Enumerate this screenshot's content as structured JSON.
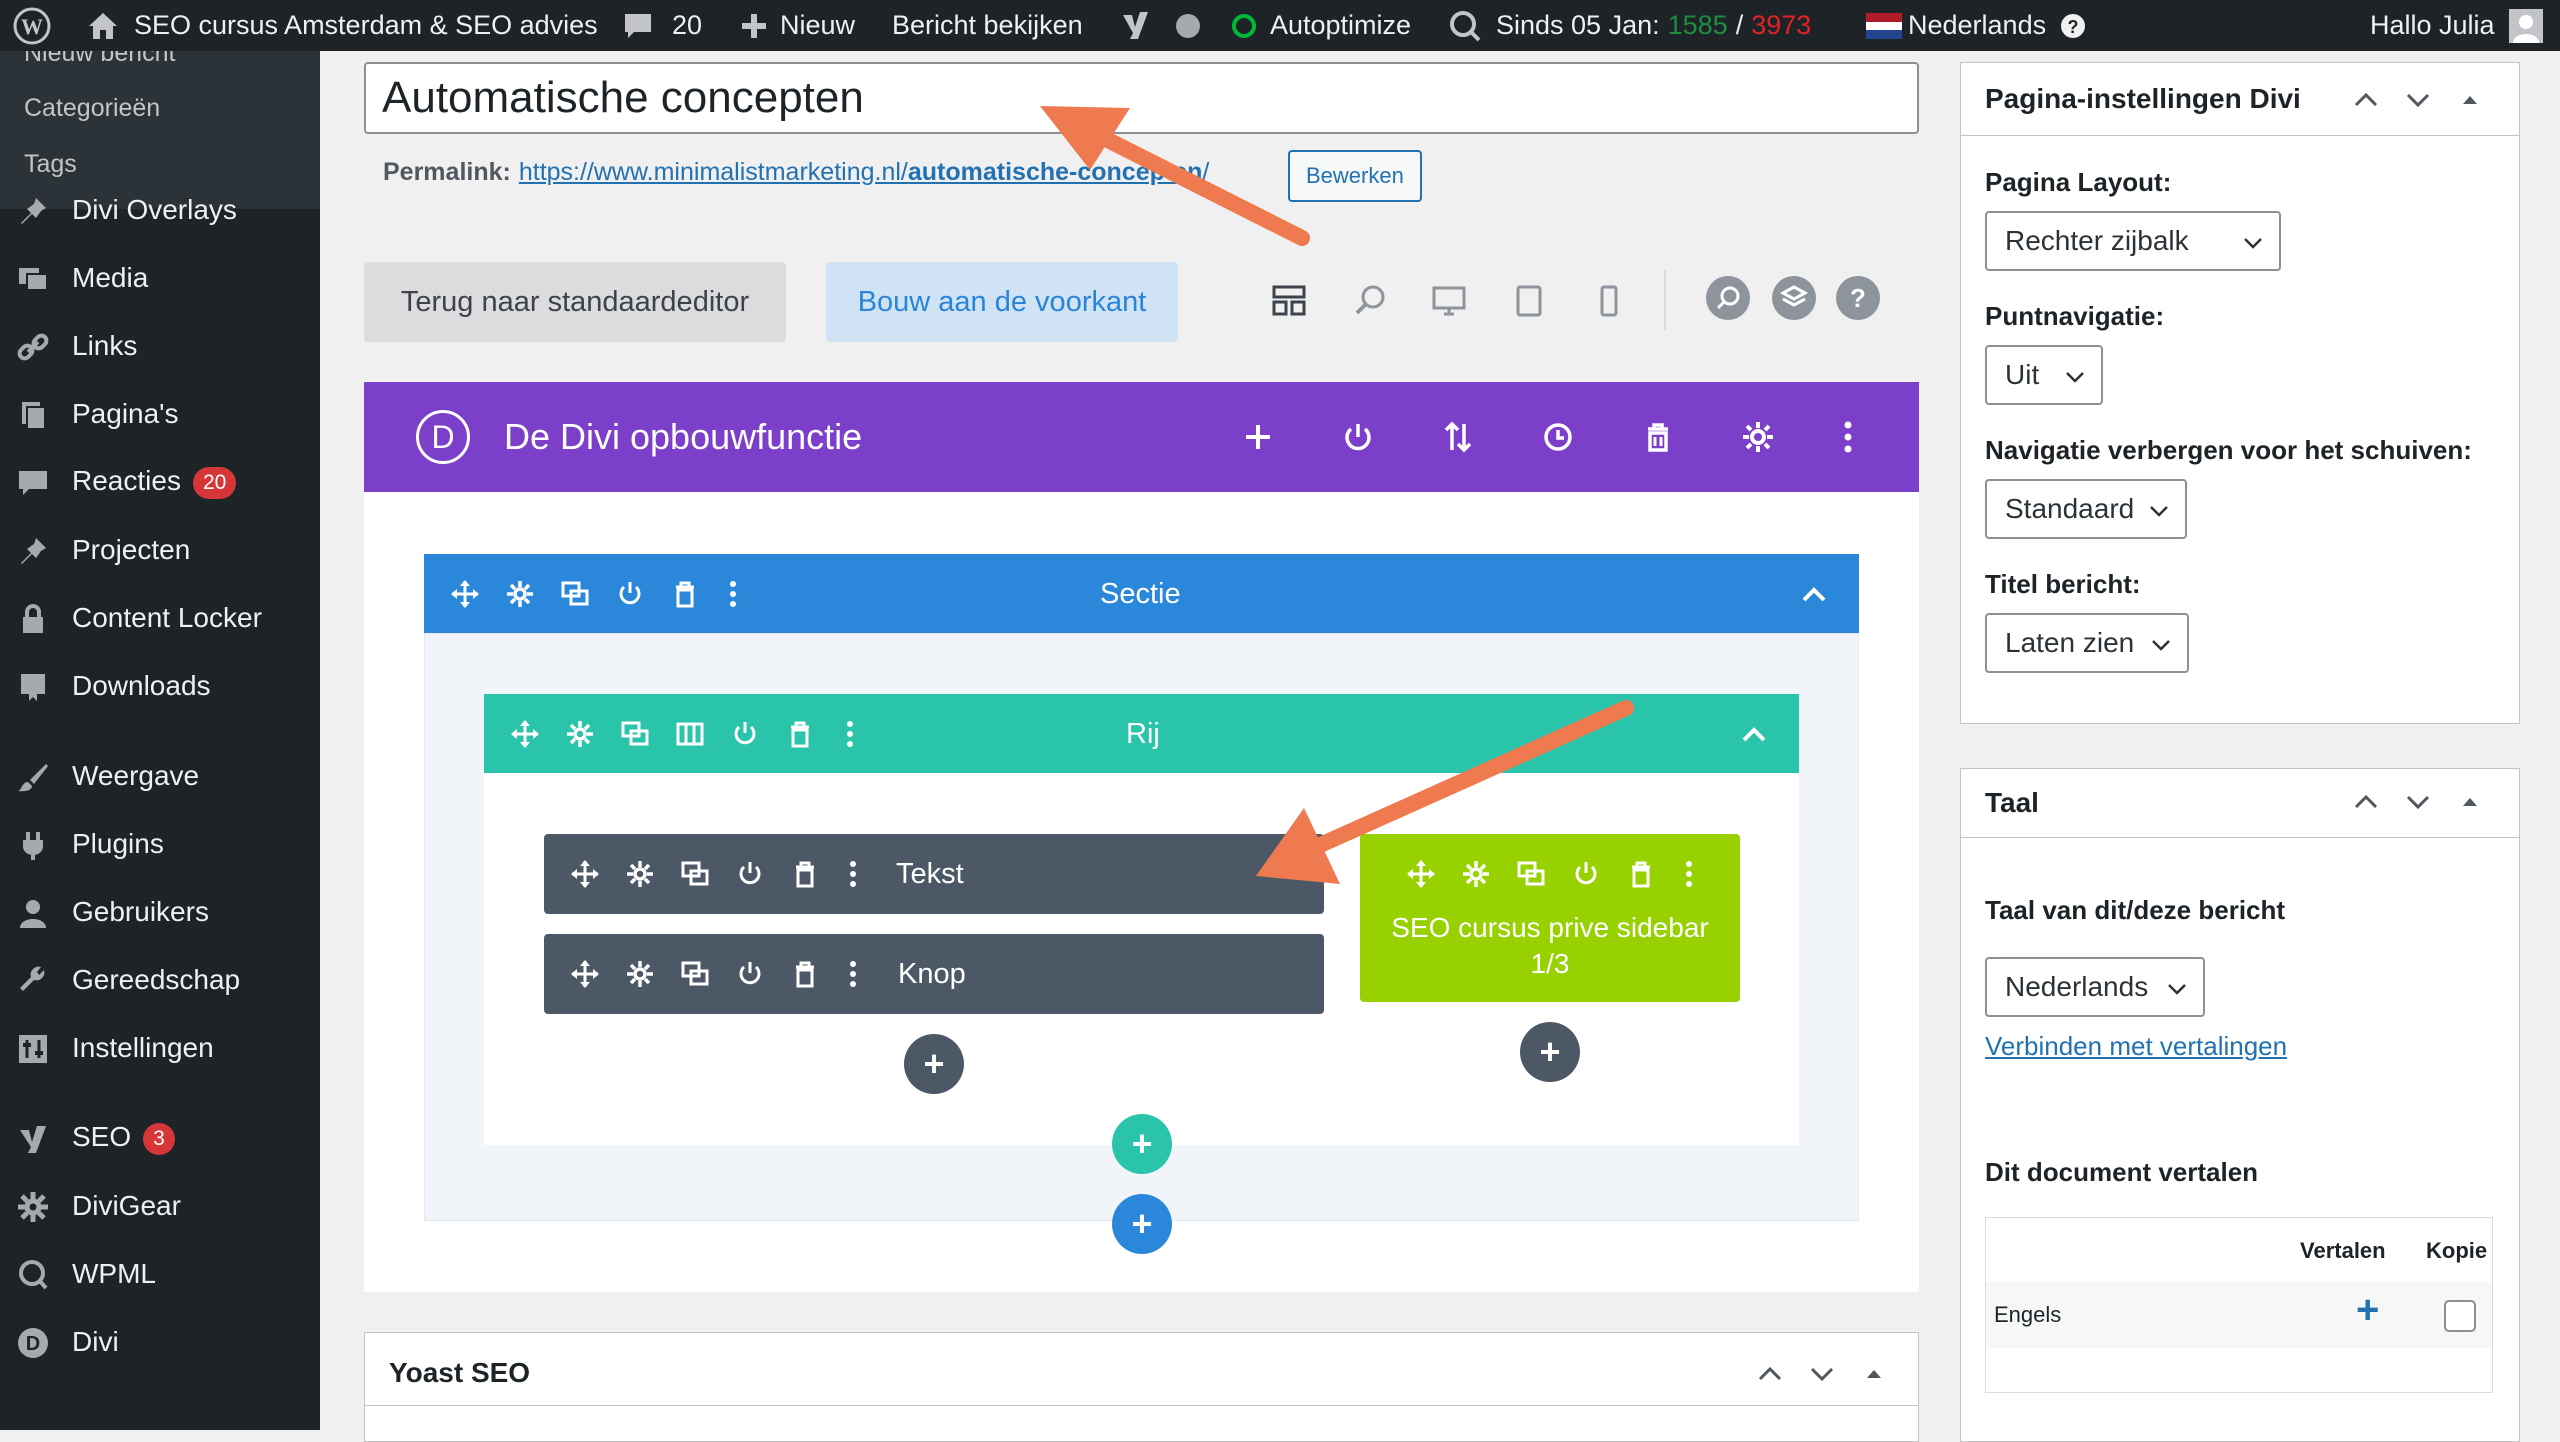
{
  "adminbar": {
    "site_name": "SEO cursus Amsterdam & SEO advies",
    "comments_count": "20",
    "new_label": "Nieuw",
    "view_post": "Bericht bekijken",
    "autoptimize": "Autoptimize",
    "since_label": "Sinds 05 Jan:",
    "stat_green": "1585",
    "stat_sep": "/",
    "stat_red": "3973",
    "language": "Nederlands",
    "greeting": "Hallo Julia"
  },
  "sidebar": {
    "sub_items": [
      "Nieuw bericht",
      "Categorieën",
      "Tags"
    ],
    "items": [
      {
        "label": "Divi Overlays",
        "icon": "pin-icon"
      },
      {
        "label": "Media",
        "icon": "media-icon"
      },
      {
        "label": "Links",
        "icon": "links-icon"
      },
      {
        "label": "Pagina's",
        "icon": "pages-icon"
      },
      {
        "label": "Reacties",
        "icon": "comments-icon",
        "badge": "20"
      },
      {
        "label": "Projecten",
        "icon": "pin-icon"
      },
      {
        "label": "Content Locker",
        "icon": "lock-icon"
      },
      {
        "label": "Downloads",
        "icon": "download-icon"
      },
      {
        "label": "Weergave",
        "icon": "brush-icon"
      },
      {
        "label": "Plugins",
        "icon": "plugin-icon"
      },
      {
        "label": "Gebruikers",
        "icon": "user-icon"
      },
      {
        "label": "Gereedschap",
        "icon": "wrench-icon"
      },
      {
        "label": "Instellingen",
        "icon": "settings-icon"
      },
      {
        "label": "SEO",
        "icon": "yoast-icon",
        "badge": "3"
      },
      {
        "label": "DiviGear",
        "icon": "gear-icon"
      },
      {
        "label": "WPML",
        "icon": "wpml-icon"
      },
      {
        "label": "Divi",
        "icon": "divi-icon"
      }
    ]
  },
  "editor": {
    "title_value": "Automatische concepten",
    "permalink_label": "Permalink:",
    "permalink_base": "https://www.minimalistmarketing.nl/",
    "permalink_slug": "automatische-concepten",
    "permalink_end": "/",
    "edit_button": "Bewerken",
    "back_button": "Terug naar standaardeditor",
    "frontend_button": "Bouw aan de voorkant"
  },
  "divi": {
    "builder_title": "De Divi opbouwfunctie",
    "logo_letter": "D",
    "section_label": "Sectie",
    "row_label": "Rij",
    "modules": [
      "Tekst",
      "Knop"
    ],
    "sidebar_module_line1": "SEO cursus prive sidebar",
    "sidebar_module_line2": "1/3",
    "add_symbol": "+"
  },
  "panel_settings": {
    "title": "Pagina-instellingen Divi",
    "layout_label": "Pagina Layout:",
    "layout_value": "Rechter zijbalk",
    "dotnav_label": "Puntnavigatie:",
    "dotnav_value": "Uit",
    "hidenav_label": "Navigatie verbergen voor het schuiven:",
    "hidenav_value": "Standaard",
    "posttitle_label": "Titel bericht:",
    "posttitle_value": "Laten zien"
  },
  "panel_language": {
    "title": "Taal",
    "lang_label": "Taal van dit/deze bericht",
    "lang_value": "Nederlands",
    "connect_link": "Verbinden met vertalingen",
    "translate_label": "Dit document vertalen",
    "col_translate": "Vertalen",
    "col_copy": "Kopie",
    "row_lang": "Engels",
    "add_symbol": "+"
  },
  "yoast": {
    "title": "Yoast SEO"
  },
  "colors": {
    "adminbar": "#1d2327",
    "divi_purple": "#7c3fc9",
    "section_blue": "#2b87da",
    "row_teal": "#29c4a9",
    "module_dark": "#4c5866",
    "sidebar_module_green": "#97d100",
    "arrow": "#f07a4f",
    "badge_red": "#d63638"
  }
}
